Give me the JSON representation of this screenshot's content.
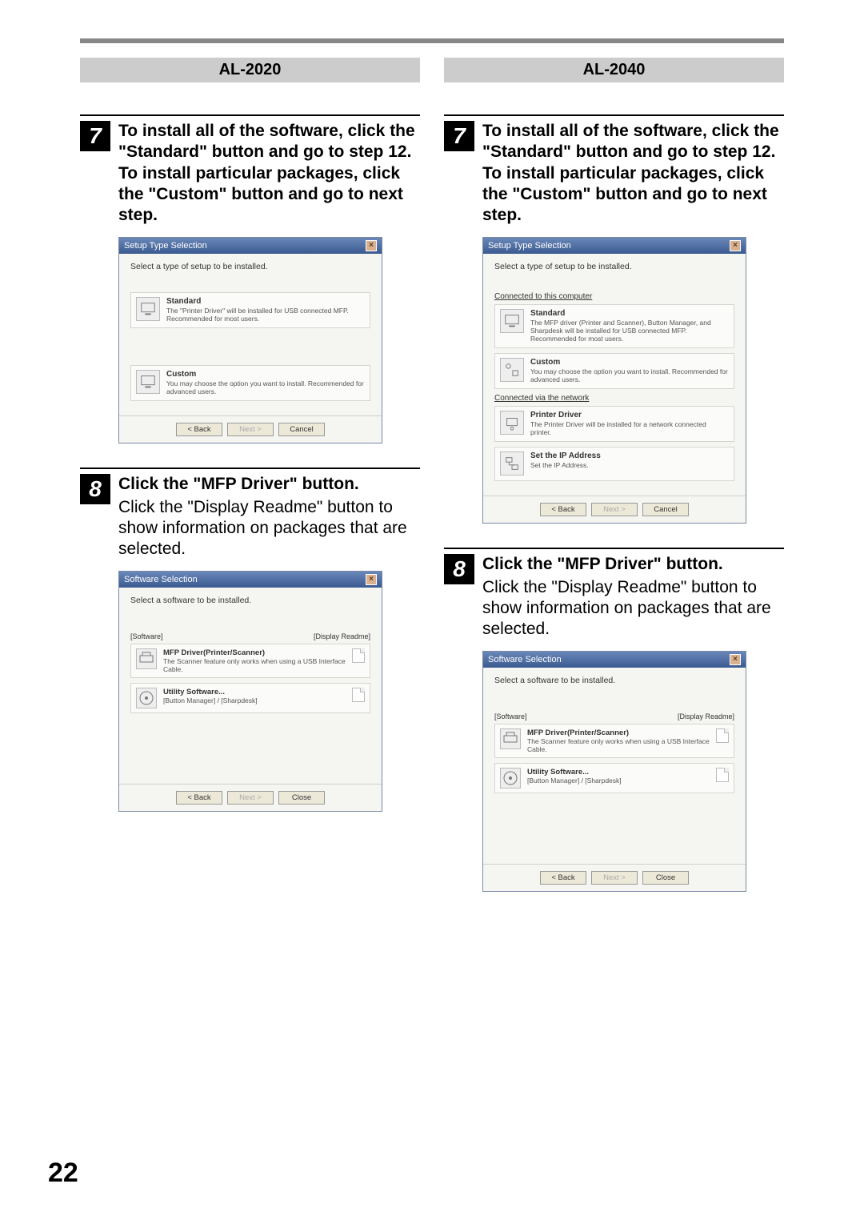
{
  "page_number": "22",
  "models": {
    "left": "AL-2020",
    "right": "AL-2040"
  },
  "steps": {
    "s7": {
      "num": "7",
      "title": "To install all of the software, click the \"Standard\" button and go to step 12.\nTo install particular packages, click the \"Custom\" button and go to next step."
    },
    "s8": {
      "num": "8",
      "title": "Click the \"MFP Driver\" button.",
      "sub": "Click the \"Display Readme\" button to show information on packages that are selected."
    }
  },
  "dialog_setup": {
    "title": "Setup Type Selection",
    "msg": "Select a type of setup to be installed.",
    "hdr_connected_this": "Connected to this computer",
    "hdr_connected_net": "Connected via the network",
    "standard": {
      "title": "Standard",
      "desc_2020": "The \"Printer Driver\" will be installed for USB connected MFP. Recommended for most users.",
      "desc_2040": "The MFP driver (Printer and Scanner), Button Manager, and Sharpdesk will be installed for USB connected MFP. Recommended for most users."
    },
    "custom": {
      "title": "Custom",
      "desc": "You may choose the option you want to install. Recommended for advanced users."
    },
    "printer_driver": {
      "title": "Printer Driver",
      "desc": "The Printer Driver will be installed for a network connected printer."
    },
    "set_ip": {
      "title": "Set the IP Address",
      "desc": "Set the IP Address."
    },
    "btn_back": "< Back",
    "btn_next": "Next >",
    "btn_cancel": "Cancel"
  },
  "dialog_sw": {
    "title": "Software Selection",
    "msg": "Select a software to be installed.",
    "col_software": "[Software]",
    "col_readme": "[Display Readme]",
    "mfp": {
      "title": "MFP Driver(Printer/Scanner)",
      "desc": "The Scanner feature only works when using a USB Interface Cable."
    },
    "util": {
      "title": "Utility Software...",
      "desc": "[Button Manager] / [Sharpdesk]"
    },
    "btn_back": "< Back",
    "btn_next": "Next >",
    "btn_close": "Close"
  }
}
